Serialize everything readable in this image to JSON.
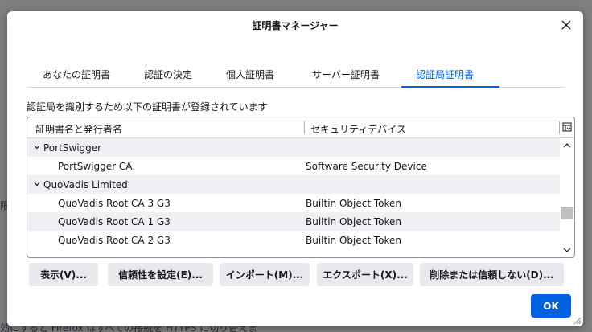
{
  "background": {
    "left_fragment": "限",
    "bottom_text": "効にすると Firefox はすべての接続を HTTPS に切り替えま"
  },
  "dialog": {
    "title": "証明書マネージャー",
    "tabs": [
      {
        "label": "あなたの証明書",
        "active": false
      },
      {
        "label": "認証の決定",
        "active": false
      },
      {
        "label": "個人証明書",
        "active": false
      },
      {
        "label": "サーバー証明書",
        "active": false
      },
      {
        "label": "認証局証明書",
        "active": true
      }
    ],
    "description": "認証局を識別するため以下の証明書が登録されています",
    "table": {
      "columns": [
        "証明書名と発行者名",
        "セキュリティデバイス"
      ],
      "rows": [
        {
          "name": "PortSwigger",
          "device": "",
          "group": true
        },
        {
          "name": "PortSwigger CA",
          "device": "Software Security Device",
          "group": false
        },
        {
          "name": "QuoVadis Limited",
          "device": "",
          "group": true
        },
        {
          "name": "QuoVadis Root CA 3 G3",
          "device": "Builtin Object Token",
          "group": false
        },
        {
          "name": "QuoVadis Root CA 1 G3",
          "device": "Builtin Object Token",
          "group": false
        },
        {
          "name": "QuoVadis Root CA 2 G3",
          "device": "Builtin Object Token",
          "group": false
        }
      ]
    },
    "buttons": {
      "view": "表示(V)...",
      "trust": "信頼性を設定(E)...",
      "import": "インポート(M)...",
      "export": "エクスポート(X)...",
      "delete": "削除または信頼しない(D)..."
    },
    "ok": "OK"
  },
  "colors": {
    "accent": "#0061e0",
    "alt_row": "#f0f0f4",
    "button_bg": "#e9e9ed",
    "backdrop": "#7f7f82"
  }
}
